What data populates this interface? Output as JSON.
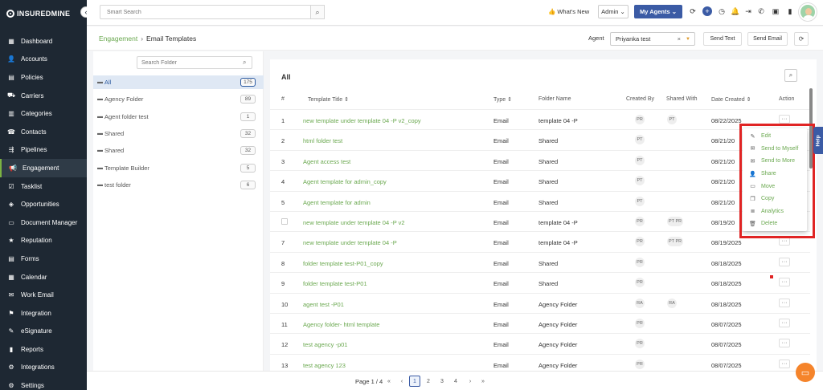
{
  "app": {
    "logo_text": "INSUREDMINE"
  },
  "sidebar": {
    "items": [
      {
        "label": "Dashboard",
        "icon": "grid-icon"
      },
      {
        "label": "Accounts",
        "icon": "accounts-icon"
      },
      {
        "label": "Policies",
        "icon": "policies-icon"
      },
      {
        "label": "Carriers",
        "icon": "carriers-icon"
      },
      {
        "label": "Categories",
        "icon": "categories-icon"
      },
      {
        "label": "Contacts",
        "icon": "contacts-icon"
      },
      {
        "label": "Pipelines",
        "icon": "pipelines-icon"
      },
      {
        "label": "Engagement",
        "icon": "megaphone-icon"
      },
      {
        "label": "Tasklist",
        "icon": "tasklist-icon"
      },
      {
        "label": "Opportunities",
        "icon": "opportunities-icon"
      },
      {
        "label": "Document Manager",
        "icon": "folder-icon"
      },
      {
        "label": "Reputation",
        "icon": "reputation-icon"
      },
      {
        "label": "Forms",
        "icon": "forms-icon"
      },
      {
        "label": "Calendar",
        "icon": "calendar-icon"
      },
      {
        "label": "Work Email",
        "icon": "email-icon"
      },
      {
        "label": "Integration",
        "icon": "integration-icon"
      },
      {
        "label": "eSignature",
        "icon": "esignature-icon"
      },
      {
        "label": "Reports",
        "icon": "reports-icon"
      },
      {
        "label": "Integrations",
        "icon": "integrations-icon"
      },
      {
        "label": "Settings",
        "icon": "gear-icon"
      }
    ],
    "active": "Engagement"
  },
  "topbar": {
    "search_placeholder": "Smart Search",
    "whats_new": "What's New",
    "role_select": "Admin",
    "agents_button": "My Agents"
  },
  "subbar": {
    "breadcrumb_root": "Engagement",
    "breadcrumb_current": "Email Templates",
    "agent_label": "Agent",
    "agent_value": "Priyanka test",
    "send_text": "Send Text",
    "send_email": "Send Email"
  },
  "folders": {
    "search_placeholder": "Search Folder",
    "items": [
      {
        "name": "All",
        "count": "175",
        "selected": true
      },
      {
        "name": "Agency Folder",
        "count": "89"
      },
      {
        "name": "Agent folder test",
        "count": "1"
      },
      {
        "name": "Shared",
        "count": "32"
      },
      {
        "name": "Shared",
        "count": "32"
      },
      {
        "name": "Template Builder",
        "count": "5"
      },
      {
        "name": "test folder",
        "count": "6"
      }
    ]
  },
  "table": {
    "title": "All",
    "headers": {
      "num": "#",
      "title": "Template Title ⇕",
      "type": "Type ⇕",
      "folder": "Folder Name",
      "created_by": "Created By",
      "shared_with": "Shared With",
      "date": "Date Created ⇕",
      "action": "Action"
    },
    "rows": [
      {
        "num": "1",
        "title": "new template under template 04 -P v2_copy",
        "type": "Email",
        "folder": "template 04 -P",
        "created_by": "PR",
        "shared_with": "PT",
        "date": "08/22/2025"
      },
      {
        "num": "2",
        "title": "html folder test",
        "type": "Email",
        "folder": "Shared",
        "created_by": "PT",
        "shared_with": "",
        "date": "08/21/20"
      },
      {
        "num": "3",
        "title": "Agent access test",
        "type": "Email",
        "folder": "Shared",
        "created_by": "PT",
        "shared_with": "",
        "date": "08/21/20"
      },
      {
        "num": "4",
        "title": "Agent template for admin_copy",
        "type": "Email",
        "folder": "Shared",
        "created_by": "PT",
        "shared_with": "",
        "date": "08/21/20"
      },
      {
        "num": "5",
        "title": "Agent template for admin",
        "type": "Email",
        "folder": "Shared",
        "created_by": "PT",
        "shared_with": "",
        "date": "08/21/20"
      },
      {
        "num": "",
        "checkbox": true,
        "title": "new template under template 04 -P v2",
        "type": "Email",
        "folder": "template 04 -P",
        "created_by": "PR",
        "shared_with": "PT PR",
        "date": "08/19/20"
      },
      {
        "num": "7",
        "title": "new template under template 04 -P",
        "type": "Email",
        "folder": "template 04 -P",
        "created_by": "PR",
        "shared_with": "PT PR",
        "date": "08/19/2025"
      },
      {
        "num": "8",
        "title": "folder template test-P01_copy",
        "type": "Email",
        "folder": "Shared",
        "created_by": "PR",
        "shared_with": "",
        "date": "08/18/2025"
      },
      {
        "num": "9",
        "title": "folder template test-P01",
        "type": "Email",
        "folder": "Shared",
        "created_by": "PR",
        "shared_with": "",
        "date": "08/18/2025"
      },
      {
        "num": "10",
        "title": "agent test -P01",
        "type": "Email",
        "folder": "Agency Folder",
        "created_by": "RA",
        "shared_with": "RA",
        "date": "08/18/2025"
      },
      {
        "num": "11",
        "title": "Agency folder- html template",
        "type": "Email",
        "folder": "Agency Folder",
        "created_by": "PR",
        "shared_with": "",
        "date": "08/07/2025"
      },
      {
        "num": "12",
        "title": "test agency -p01",
        "type": "Email",
        "folder": "Agency Folder",
        "created_by": "PR",
        "shared_with": "",
        "date": "08/07/2025"
      },
      {
        "num": "13",
        "title": "test agency 123",
        "type": "Email",
        "folder": "Agency Folder",
        "created_by": "PR",
        "shared_with": "",
        "date": "08/07/2025"
      }
    ],
    "action_label": "···"
  },
  "context_menu": {
    "items": [
      {
        "label": "Edit",
        "icon": "pencil-icon"
      },
      {
        "label": "Send to Myself",
        "icon": "envelope-icon"
      },
      {
        "label": "Send to More",
        "icon": "envelope-icon"
      },
      {
        "label": "Share",
        "icon": "user-icon"
      },
      {
        "label": "Move",
        "icon": "folder-icon"
      },
      {
        "label": "Copy",
        "icon": "copy-icon"
      },
      {
        "label": "Analytics",
        "icon": "analytics-icon"
      },
      {
        "label": "Delete",
        "icon": "trash-icon"
      }
    ]
  },
  "help": {
    "label": "Help"
  },
  "pagination": {
    "info": "Page 1 / 4",
    "first": "«",
    "prev": "‹",
    "pages": [
      "1",
      "2",
      "3",
      "4"
    ],
    "next": "›",
    "last": "»",
    "current": "1"
  },
  "colors": {
    "accent": "#6aa84f",
    "brand": "#3b5ba5",
    "sidebar": "#1e2833",
    "highlight": "#e02424"
  }
}
